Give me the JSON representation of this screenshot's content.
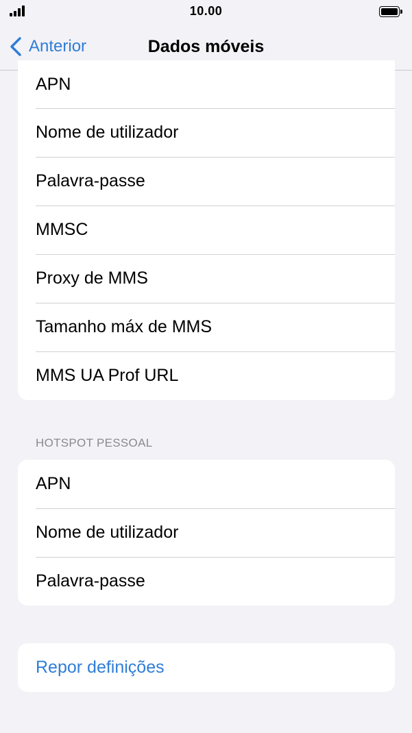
{
  "status_bar": {
    "time": "10.00"
  },
  "nav": {
    "back_label": "Anterior",
    "title": "Dados móveis"
  },
  "mms_settings": {
    "items": [
      {
        "label": "APN"
      },
      {
        "label": "Nome de utilizador"
      },
      {
        "label": "Palavra-passe"
      },
      {
        "label": "MMSC"
      },
      {
        "label": "Proxy de MMS"
      },
      {
        "label": "Tamanho máx de MMS"
      },
      {
        "label": "MMS UA Prof URL"
      }
    ]
  },
  "hotspot": {
    "header": "HOTSPOT PESSOAL",
    "items": [
      {
        "label": "APN"
      },
      {
        "label": "Nome de utilizador"
      },
      {
        "label": "Palavra-passe"
      }
    ]
  },
  "reset": {
    "label": "Repor definições"
  },
  "colors": {
    "accent": "#2f7dd6",
    "background": "#f2f2f7",
    "card": "#ffffff"
  }
}
